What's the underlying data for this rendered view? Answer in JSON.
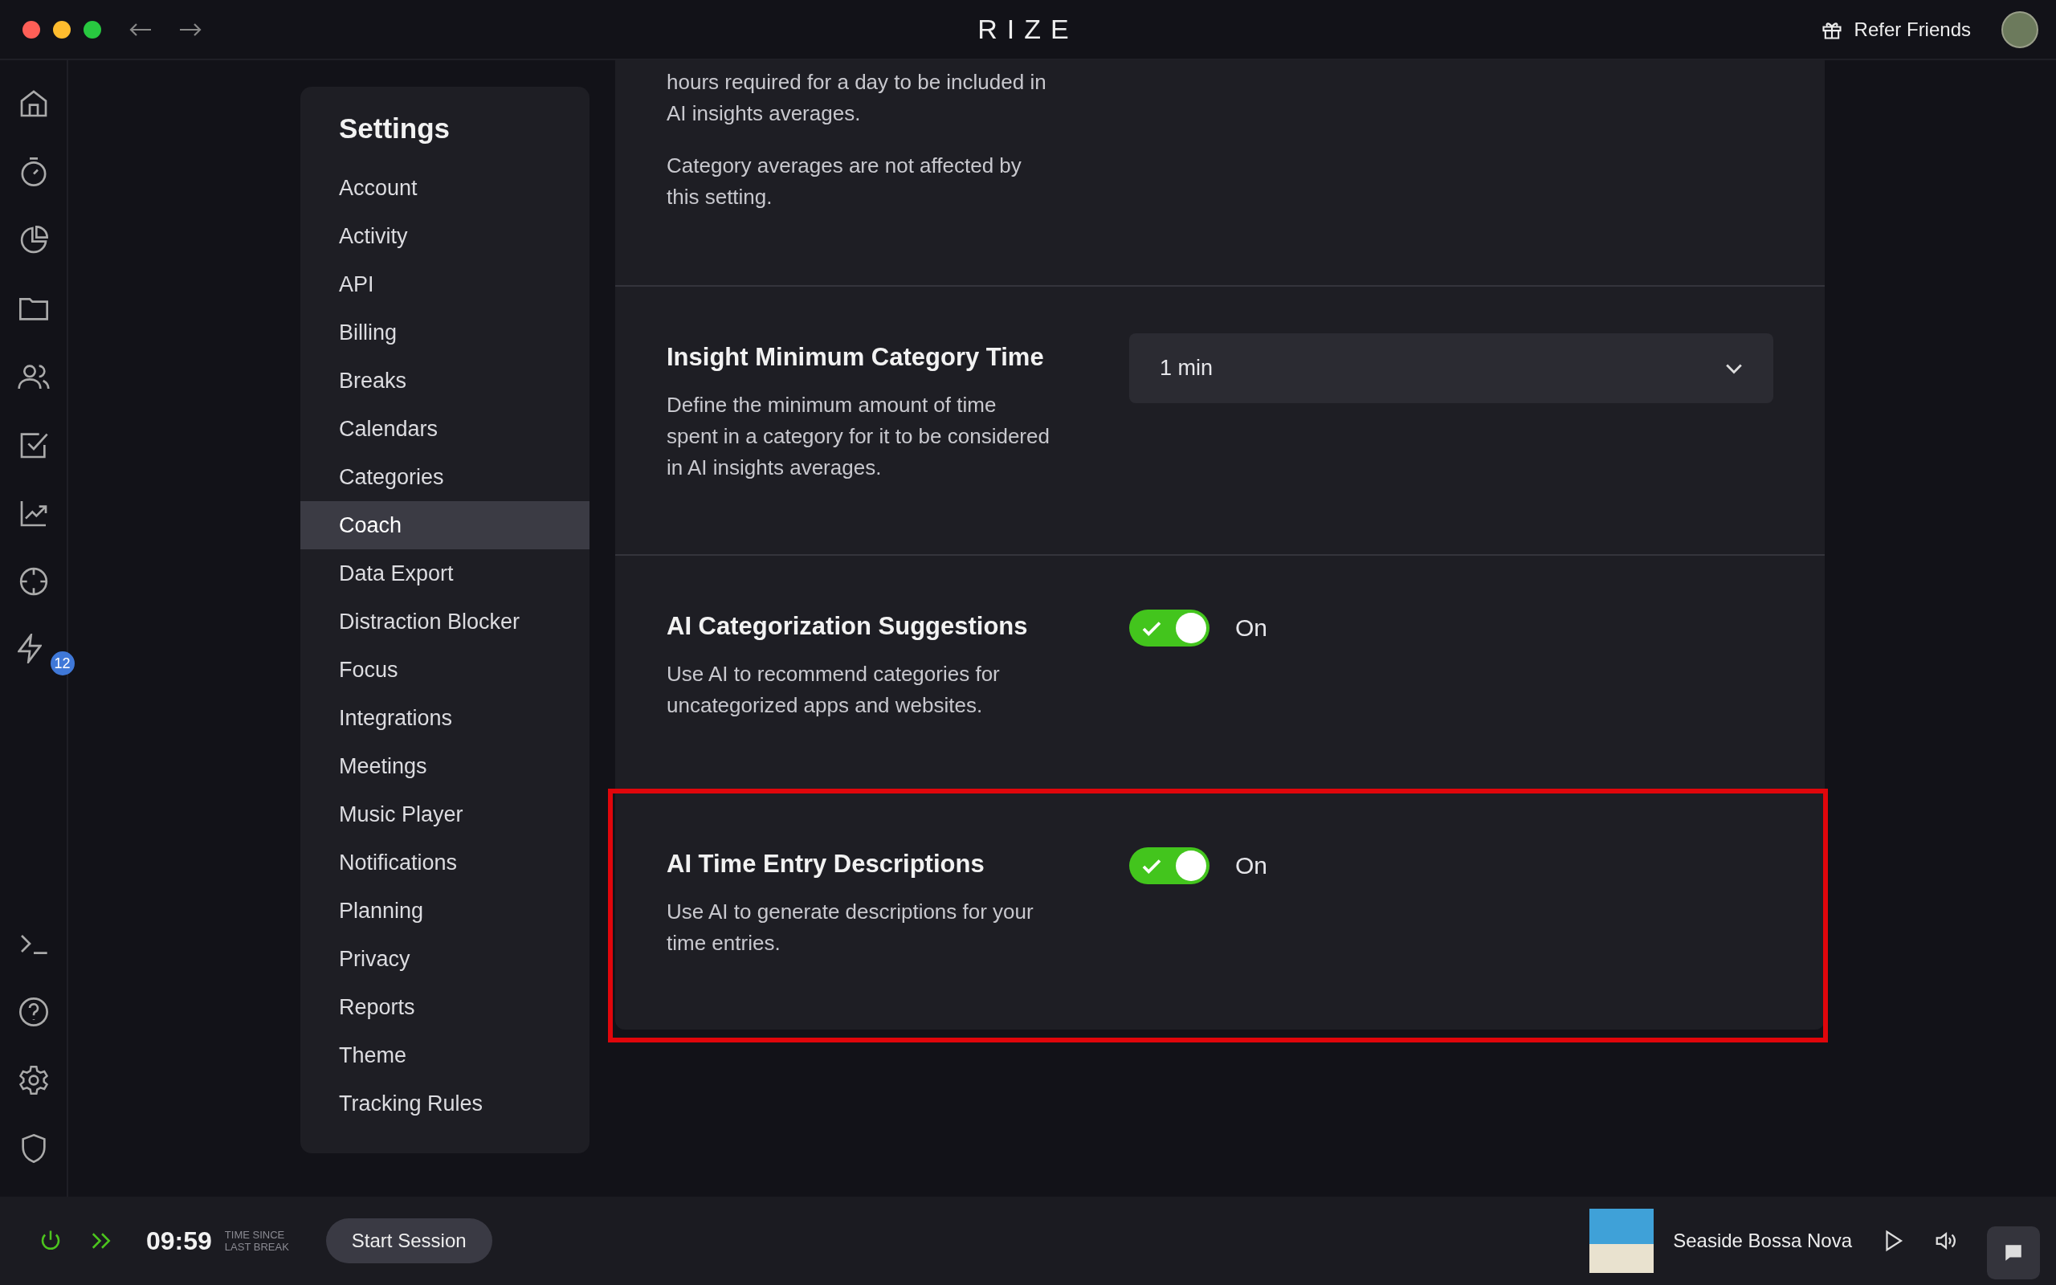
{
  "window": {
    "title": "RIZE"
  },
  "header": {
    "refer_label": "Refer Friends"
  },
  "rail": {
    "badge": "12"
  },
  "settings": {
    "title": "Settings",
    "items": [
      {
        "label": "Account",
        "selected": false
      },
      {
        "label": "Activity",
        "selected": false
      },
      {
        "label": "API",
        "selected": false
      },
      {
        "label": "Billing",
        "selected": false
      },
      {
        "label": "Breaks",
        "selected": false
      },
      {
        "label": "Calendars",
        "selected": false
      },
      {
        "label": "Categories",
        "selected": false
      },
      {
        "label": "Coach",
        "selected": true
      },
      {
        "label": "Data Export",
        "selected": false
      },
      {
        "label": "Distraction Blocker",
        "selected": false
      },
      {
        "label": "Focus",
        "selected": false
      },
      {
        "label": "Integrations",
        "selected": false
      },
      {
        "label": "Meetings",
        "selected": false
      },
      {
        "label": "Music Player",
        "selected": false
      },
      {
        "label": "Notifications",
        "selected": false
      },
      {
        "label": "Planning",
        "selected": false
      },
      {
        "label": "Privacy",
        "selected": false
      },
      {
        "label": "Reports",
        "selected": false
      },
      {
        "label": "Theme",
        "selected": false
      },
      {
        "label": "Tracking Rules",
        "selected": false
      }
    ]
  },
  "sections": [
    {
      "kind": "text",
      "highlighted": false,
      "paragraphs": [
        "hours required for a day to be included in AI insights averages.",
        "Category averages are not affected by this setting."
      ]
    },
    {
      "kind": "select",
      "highlighted": false,
      "title": "Insight Minimum Category Time",
      "paragraphs": [
        "Define the minimum amount of time spent in a category for it to be considered in AI insights averages."
      ],
      "value": "1 min"
    },
    {
      "kind": "toggle",
      "highlighted": false,
      "title": "AI Categorization Suggestions",
      "paragraphs": [
        "Use AI to recommend categories for uncategorized apps and websites."
      ],
      "on": true,
      "state_label": "On"
    },
    {
      "kind": "toggle",
      "highlighted": true,
      "title": "AI Time Entry Descriptions",
      "paragraphs": [
        "Use AI to generate descriptions for your time entries."
      ],
      "on": true,
      "state_label": "On"
    }
  ],
  "footer": {
    "timer": "09:59",
    "timer_caption": "TIME SINCE LAST BREAK",
    "session_button": "Start Session",
    "track": "Seaside Bossa Nova"
  }
}
